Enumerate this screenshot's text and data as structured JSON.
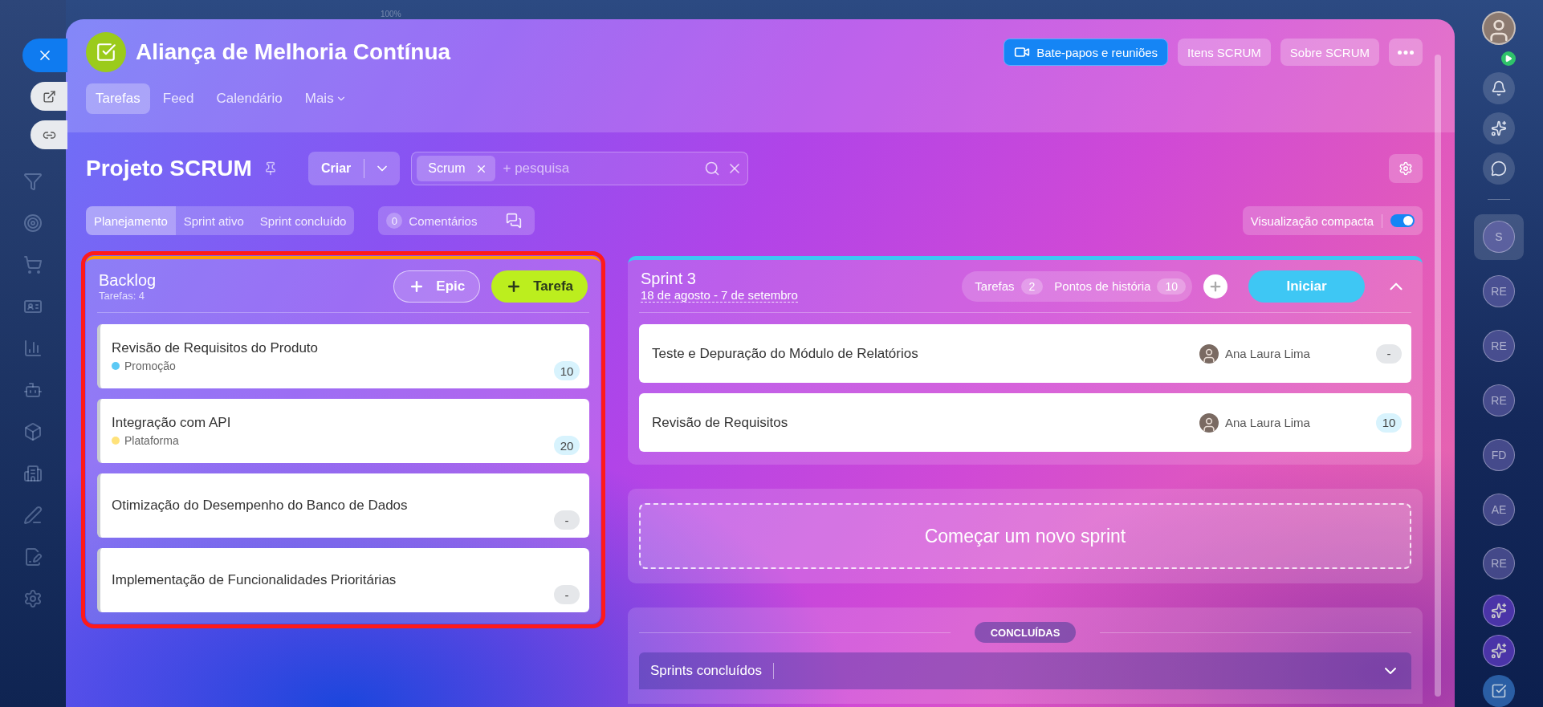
{
  "top_bar": {
    "zoom": "100%"
  },
  "header": {
    "title": "Aliança de Melhoria Contínua",
    "tabs": [
      {
        "label": "Tarefas",
        "selected": true,
        "kind": "link"
      },
      {
        "label": "Feed",
        "selected": false,
        "kind": "link"
      },
      {
        "label": "Calendário",
        "selected": false,
        "kind": "link"
      },
      {
        "label": "Mais",
        "selected": false,
        "kind": "menu"
      }
    ],
    "actions": [
      {
        "label": "Bate-papos e reuniões",
        "kind": "primary"
      },
      {
        "label": "Itens SCRUM",
        "kind": "plain"
      },
      {
        "label": "Sobre SCRUM",
        "kind": "plain"
      }
    ]
  },
  "toolbar": {
    "title": "Projeto SCRUM",
    "create_button": "Criar",
    "search": {
      "tag": "Scrum",
      "placeholder": "+ pesquisa"
    }
  },
  "view_tabs": [
    {
      "label": "Planejamento",
      "selected": true
    },
    {
      "label": "Sprint ativo",
      "selected": false
    },
    {
      "label": "Sprint concluído",
      "selected": false
    }
  ],
  "comments": {
    "count": "0",
    "label": "Comentários"
  },
  "compact_view": {
    "label": "Visualização compacta",
    "on": true
  },
  "backlog": {
    "title": "Backlog",
    "count_label": "Tarefas: 4",
    "buttons": [
      {
        "label": "Epic",
        "kind": "outline"
      },
      {
        "label": "Tarefa",
        "kind": "accent"
      }
    ],
    "items": [
      {
        "title": "Revisão de Requisitos do Produto",
        "epic": {
          "name": "Promoção",
          "color": "#5cc9f5"
        },
        "points": "10",
        "estimated": true
      },
      {
        "title": "Integração com API",
        "epic": {
          "name": "Plataforma",
          "color": "#ffe27a"
        },
        "points": "20",
        "estimated": true
      },
      {
        "title": "Otimização do Desempenho do Banco de Dados",
        "points": "-",
        "estimated": false
      },
      {
        "title": "Implementação de Funcionalidades Prioritárias",
        "points": "-",
        "estimated": false
      }
    ]
  },
  "sprint": {
    "title": "Sprint 3",
    "dates": "18 de agosto - 7 de setembro",
    "stats": [
      {
        "label": "Tarefas",
        "value": "2"
      },
      {
        "label": "Pontos de história",
        "value": "10"
      }
    ],
    "start_button": "Iniciar",
    "expanded": true,
    "items": [
      {
        "title": "Teste e Depuração do Módulo de Relatórios",
        "assignee": "Ana Laura Lima",
        "points": "-",
        "estimated": false
      },
      {
        "title": "Revisão de Requisitos",
        "assignee": "Ana Laura Lima",
        "points": "10",
        "estimated": true
      }
    ]
  },
  "new_sprint": "Começar um novo sprint",
  "completed": {
    "divider_label": "CONCLUÍDAS",
    "section_title": "Sprints concluídos"
  },
  "right_sidebar": {
    "contacts": [
      {
        "initials": "S",
        "selected": true
      },
      {
        "initials": "RE",
        "selected": false
      },
      {
        "initials": "RE",
        "selected": false
      },
      {
        "initials": "RE",
        "selected": false
      },
      {
        "initials": "FD",
        "selected": false
      },
      {
        "initials": "AE",
        "selected": false
      },
      {
        "initials": "RE",
        "selected": false
      }
    ]
  }
}
